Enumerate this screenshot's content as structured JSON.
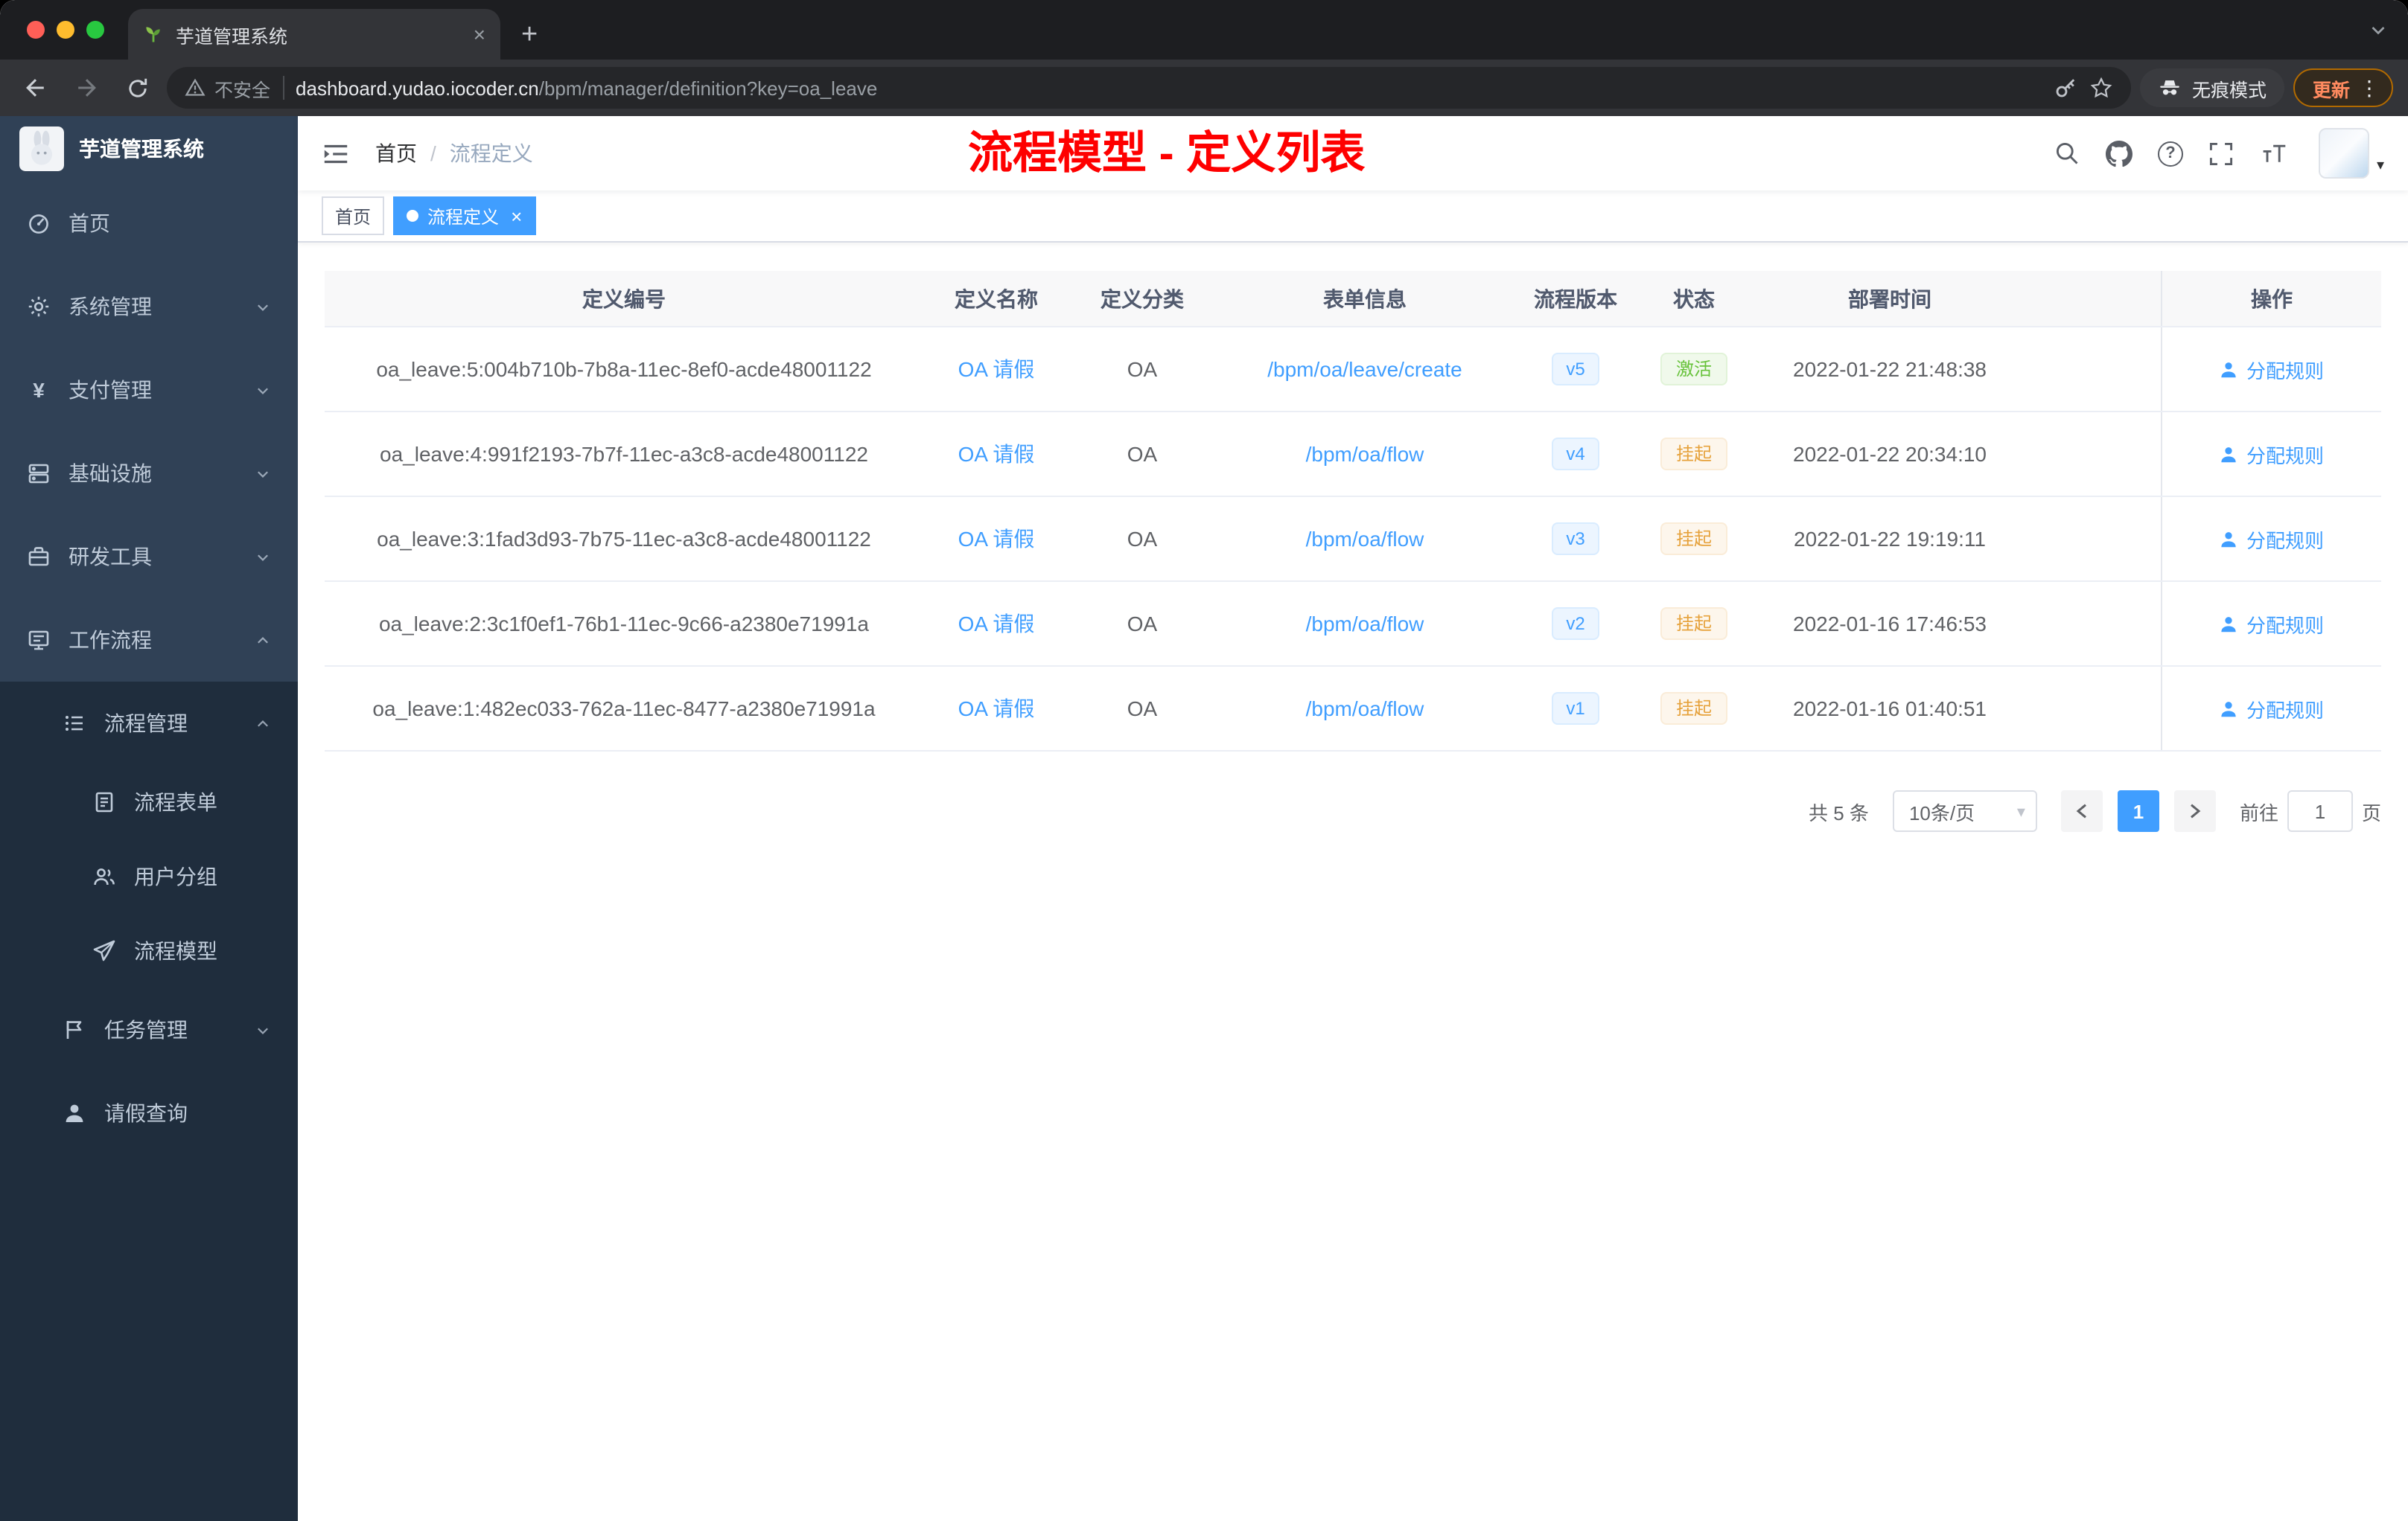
{
  "browser": {
    "tab": {
      "title": "芋道管理系统"
    },
    "address": {
      "security_label": "不安全",
      "url_host": "dashboard.yudao.iocoder.cn",
      "url_path": "/bpm/manager/definition?key=oa_leave"
    },
    "incognito_label": "无痕模式",
    "update_label": "更新"
  },
  "sidebar": {
    "logo_title": "芋道管理系统",
    "items": [
      {
        "label": "首页"
      },
      {
        "label": "系统管理"
      },
      {
        "label": "支付管理"
      },
      {
        "label": "基础设施"
      },
      {
        "label": "研发工具"
      },
      {
        "label": "工作流程"
      }
    ],
    "workflow": {
      "process_mgmt": "流程管理",
      "children": [
        {
          "label": "流程表单"
        },
        {
          "label": "用户分组"
        },
        {
          "label": "流程模型"
        }
      ],
      "task_mgmt": "任务管理",
      "leave_query": "请假查询"
    }
  },
  "header": {
    "breadcrumb_home": "首页",
    "breadcrumb_current": "流程定义",
    "annotation": "流程模型 - 定义列表"
  },
  "tags": {
    "home": "首页",
    "active": "流程定义"
  },
  "table": {
    "columns": [
      "定义编号",
      "定义名称",
      "定义分类",
      "表单信息",
      "流程版本",
      "状态",
      "部署时间",
      "操作"
    ],
    "rows": [
      {
        "id": "oa_leave:5:004b710b-7b8a-11ec-8ef0-acde48001122",
        "name": "OA 请假",
        "category": "OA",
        "form": "/bpm/oa/leave/create",
        "version": "v5",
        "status": "激活",
        "status_type": "success",
        "time": "2022-01-22 21:48:38",
        "action": "分配规则"
      },
      {
        "id": "oa_leave:4:991f2193-7b7f-11ec-a3c8-acde48001122",
        "name": "OA 请假",
        "category": "OA",
        "form": "/bpm/oa/flow",
        "version": "v4",
        "status": "挂起",
        "status_type": "warning",
        "time": "2022-01-22 20:34:10",
        "action": "分配规则"
      },
      {
        "id": "oa_leave:3:1fad3d93-7b75-11ec-a3c8-acde48001122",
        "name": "OA 请假",
        "category": "OA",
        "form": "/bpm/oa/flow",
        "version": "v3",
        "status": "挂起",
        "status_type": "warning",
        "time": "2022-01-22 19:19:11",
        "action": "分配规则"
      },
      {
        "id": "oa_leave:2:3c1f0ef1-76b1-11ec-9c66-a2380e71991a",
        "name": "OA 请假",
        "category": "OA",
        "form": "/bpm/oa/flow",
        "version": "v2",
        "status": "挂起",
        "status_type": "warning",
        "time": "2022-01-16 17:46:53",
        "action": "分配规则"
      },
      {
        "id": "oa_leave:1:482ec033-762a-11ec-8477-a2380e71991a",
        "name": "OA 请假",
        "category": "OA",
        "form": "/bpm/oa/flow",
        "version": "v1",
        "status": "挂起",
        "status_type": "warning",
        "time": "2022-01-16 01:40:51",
        "action": "分配规则"
      }
    ]
  },
  "pagination": {
    "total": "共 5 条",
    "page_size": "10条/页",
    "current_page": "1",
    "goto_label": "前往",
    "goto_value": "1",
    "page_label": "页"
  },
  "icons": {
    "new_tab": "+",
    "tab_close": "×",
    "tag_close": "×",
    "menu_dots": "⋮",
    "yen": "¥",
    "breadcrumb_separator": "/",
    "caret_down": "▾",
    "question_mark": "?"
  },
  "colors": {
    "accent": "#409EFF",
    "annotation_red": "#FE0000",
    "status_active_green": "#67C23A",
    "status_suspend_orange": "#E6A23C",
    "sidebar_bg": "#304156",
    "sidebar_submenu_bg": "#1F2D3D"
  }
}
